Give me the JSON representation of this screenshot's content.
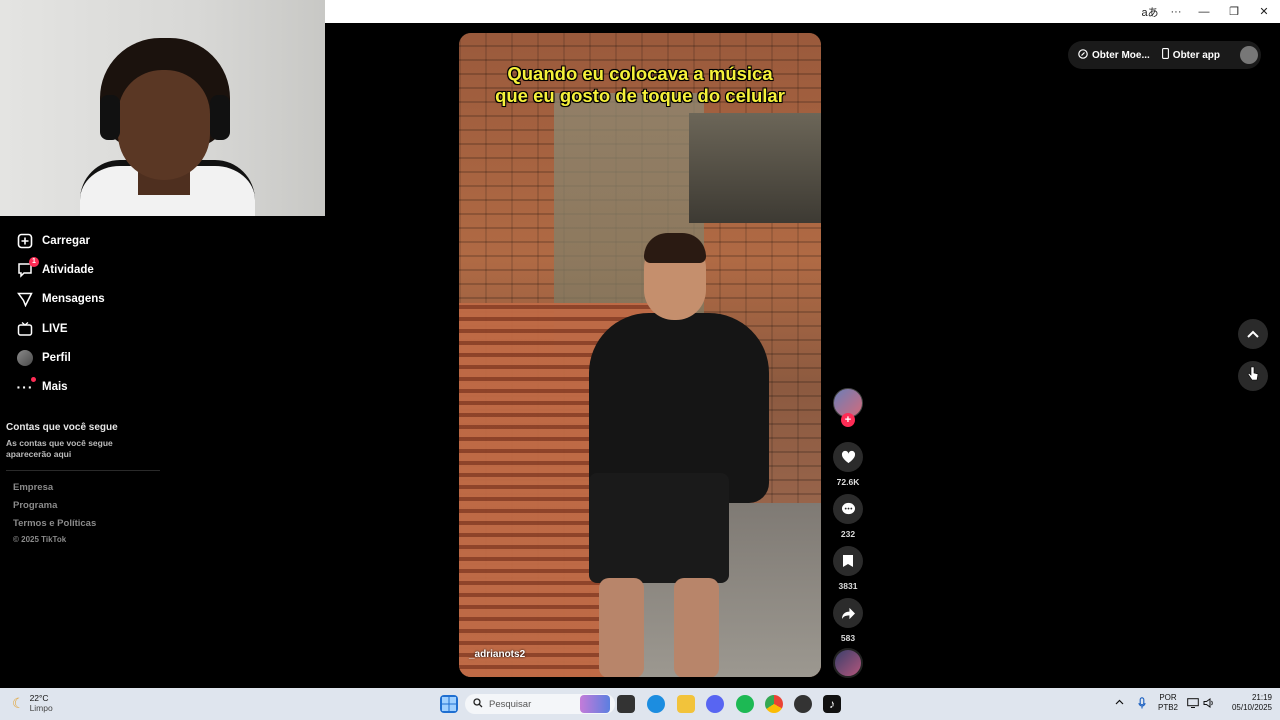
{
  "window": {
    "controls": [
      "aあ",
      "···",
      "—",
      "❐",
      "✕"
    ]
  },
  "sidebar": {
    "items": [
      {
        "label": "Carregar",
        "icon": "upload-icon"
      },
      {
        "label": "Atividade",
        "icon": "activity-icon",
        "badge": "1"
      },
      {
        "label": "Mensagens",
        "icon": "messages-icon"
      },
      {
        "label": "LIVE",
        "icon": "live-icon"
      },
      {
        "label": "Perfil",
        "icon": "profile-avatar-icon"
      },
      {
        "label": "Mais",
        "icon": "more-icon"
      }
    ],
    "following_heading": "Contas que você segue",
    "following_text": "As contas que você segue aparecerão aqui",
    "footer_links": [
      "Empresa",
      "Programa",
      "Termos e Políticas"
    ],
    "copyright": "© 2025 TikTok"
  },
  "video": {
    "caption_line1": "Quando eu colocava a música",
    "caption_line2": "que eu gosto de toque do celular",
    "handle": "_adrianots2"
  },
  "actions": {
    "likes": "72.6K",
    "comments": "232",
    "saves": "3831",
    "shares": "583"
  },
  "topright": {
    "coins_label": "Obter Moe...",
    "app_label": "Obter app"
  },
  "taskbar": {
    "temperature": "22°C",
    "weather": "Limpo",
    "search_placeholder": "Pesquisar",
    "lang1": "POR",
    "lang2": "PTB2",
    "time": "21:19",
    "date": "05/10/2025"
  },
  "colors": {
    "accent": "#fe2c55",
    "caption": "#f6f13a",
    "background": "#000000"
  }
}
